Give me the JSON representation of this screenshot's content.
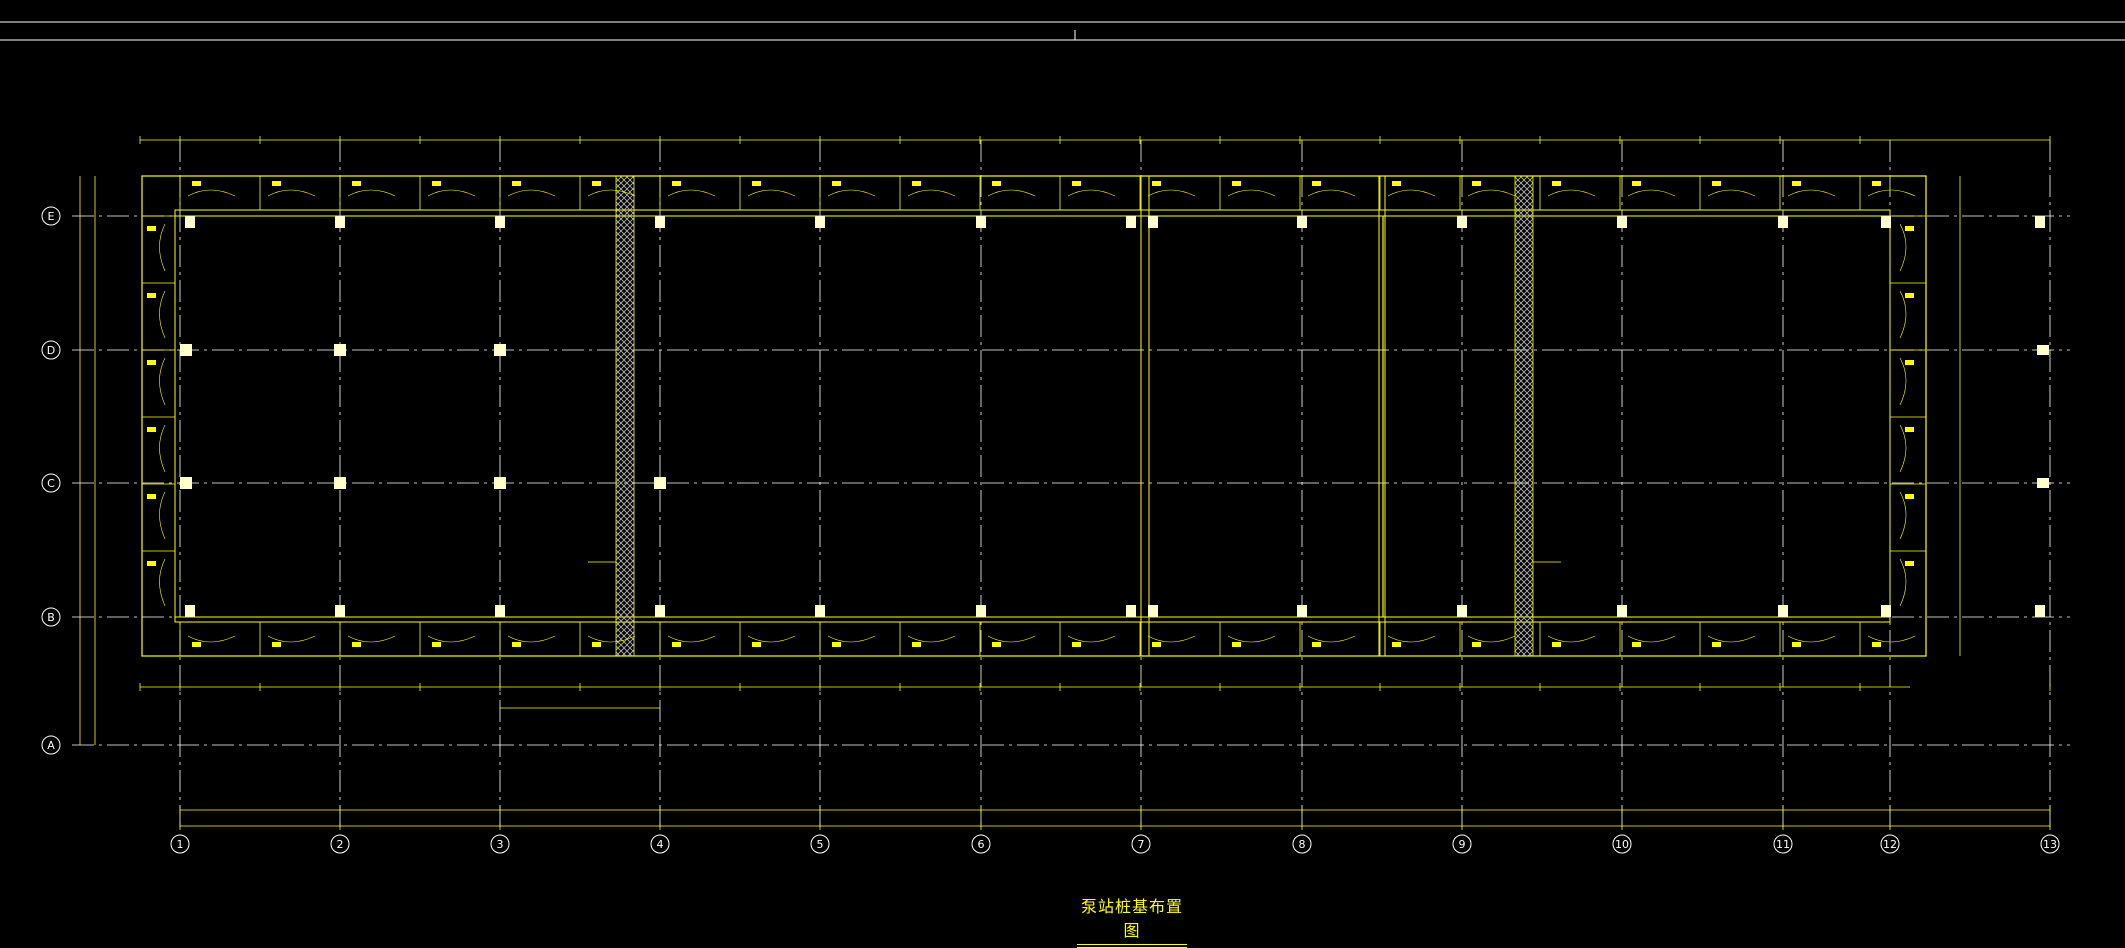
{
  "drawing": {
    "title": "泵站桩基布置图",
    "line_color": "#ffff00",
    "axis_color": "#ffffff",
    "background": "#000000",
    "hatch_color": "#cccccc"
  },
  "grid_columns": [
    "1",
    "2",
    "3",
    "4",
    "5",
    "6",
    "7",
    "8",
    "9",
    "10",
    "11",
    "12",
    "13"
  ],
  "grid_rows": [
    "E",
    "D",
    "C",
    "B",
    "A"
  ]
}
